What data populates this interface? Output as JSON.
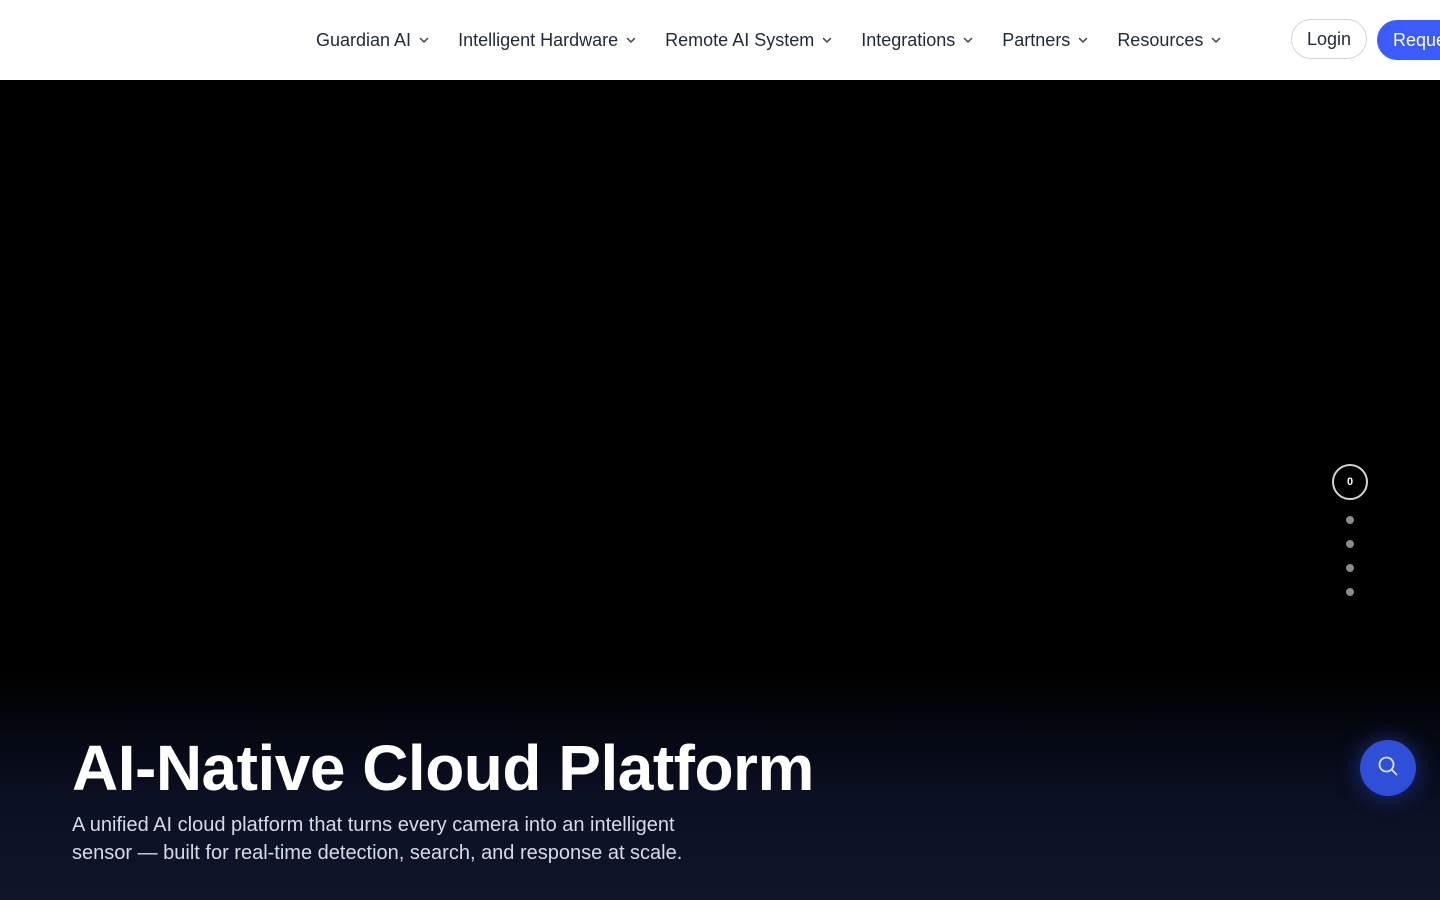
{
  "header": {
    "nav": [
      {
        "label": "Guardian AI"
      },
      {
        "label": "Intelligent Hardware"
      },
      {
        "label": "Remote AI System"
      },
      {
        "label": "Integrations"
      },
      {
        "label": "Partners"
      },
      {
        "label": "Resources"
      }
    ],
    "login_label": "Login",
    "request_label": "Reque"
  },
  "hero": {
    "title": "AI-Native Cloud Platform",
    "subtitle": "A unified AI cloud platform that turns every camera into an intelligent sensor — built for real-time detection, search, and response at scale.",
    "slides": {
      "current_label": "0",
      "count": 5
    }
  },
  "search_fab": {
    "icon": "search-icon"
  },
  "colors": {
    "accent": "#3b5bfd",
    "hero_bg": "#000000",
    "hero_bottom": "#10152a"
  }
}
